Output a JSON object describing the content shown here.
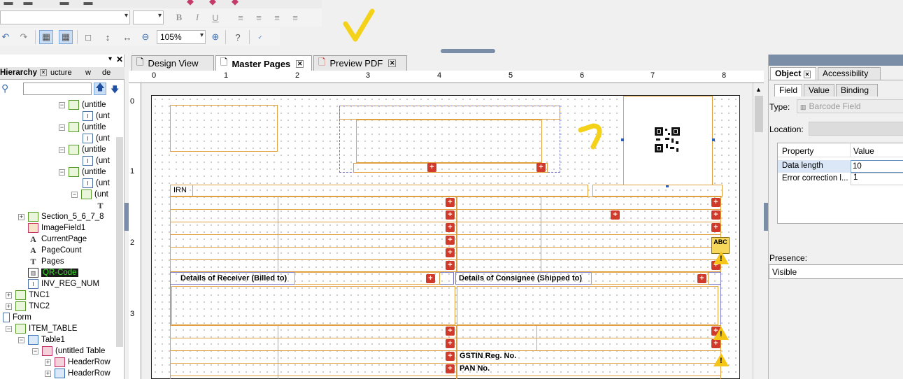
{
  "toolbar": {
    "zoom_value": "105%",
    "font_size_value": "",
    "font_name_value": "",
    "bold_label": "B",
    "italic_label": "I",
    "underline_label": "U"
  },
  "left_panel": {
    "tabs": [
      "Hierarchy",
      "ucture",
      "w",
      "de"
    ],
    "search_value": "",
    "tree": [
      {
        "label": "(untitle",
        "indent": 0
      },
      {
        "label": "(unt",
        "indent": 1
      },
      {
        "label": "(untitle",
        "indent": 0
      },
      {
        "label": "(unt",
        "indent": 1
      },
      {
        "label": "(untitle",
        "indent": 0
      },
      {
        "label": "(unt",
        "indent": 1
      },
      {
        "label": "(untitle",
        "indent": 0
      },
      {
        "label": "(unt",
        "indent": 1
      },
      {
        "label": "(unt",
        "indent": 1
      },
      {
        "label": "Section_5_6_7_8"
      },
      {
        "label": "ImageField1"
      },
      {
        "label": "CurrentPage"
      },
      {
        "label": "PageCount"
      },
      {
        "label": "Pages"
      },
      {
        "label": "QR-Code"
      },
      {
        "label": "INV_REG_NUM"
      },
      {
        "label": "TNC1"
      },
      {
        "label": "TNC2"
      },
      {
        "label": "Form"
      },
      {
        "label": "ITEM_TABLE"
      },
      {
        "label": "Table1"
      },
      {
        "label": "(untitled Table"
      },
      {
        "label": "HeaderRow"
      },
      {
        "label": "HeaderRow"
      }
    ]
  },
  "tabs": [
    {
      "label": "Design View"
    },
    {
      "label": "Master Pages"
    },
    {
      "label": "Preview PDF"
    }
  ],
  "ruler": {
    "h_marks": [
      "0",
      "1",
      "2",
      "3",
      "4",
      "5",
      "6",
      "7",
      "8"
    ],
    "v_marks": [
      "0",
      "1",
      "2",
      "3"
    ]
  },
  "page": {
    "irn_label": "IRN",
    "receiver_label": "Details of Receiver (Billed to)",
    "consignee_label": "Details of  Consignee (Shipped to)",
    "gstin_label": "GSTIN Reg. No.",
    "pan_label": "PAN No.",
    "abc_label": "ABC"
  },
  "right_panel": {
    "tabs": [
      "Object",
      "Accessibility"
    ],
    "subtabs": [
      "Field",
      "Value",
      "Binding"
    ],
    "type_label": "Type:",
    "type_value": "Barcode Field",
    "location_label": "Location:",
    "prop_header": "Property",
    "value_header": "Value",
    "props": [
      {
        "name": "Data length",
        "value": "10"
      },
      {
        "name": "Error correction l...",
        "value": "1"
      }
    ],
    "presence_label": "Presence:",
    "presence_value": "Visible"
  },
  "colors": {
    "accent_orange": "#e0a040",
    "plus_red": "#d03a2a",
    "annotation_yellow": "#f4d21a"
  }
}
